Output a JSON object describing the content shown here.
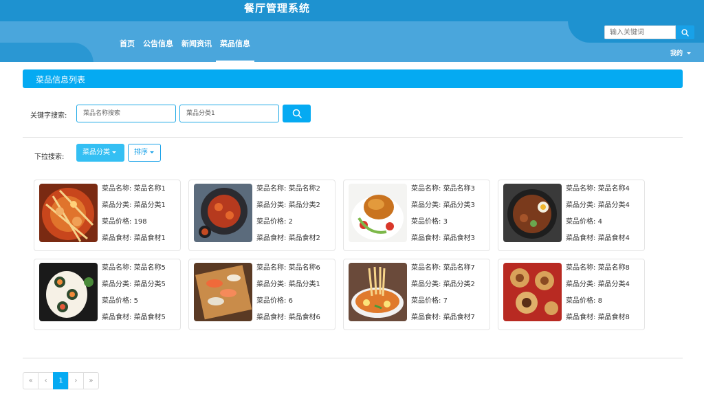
{
  "header": {
    "title": "餐厅管理系统",
    "nav": [
      "首页",
      "公告信息",
      "新闻资讯",
      "菜品信息"
    ],
    "active_nav": 3,
    "search_placeholder": "输入关键词",
    "user_menu": "我的"
  },
  "section": {
    "title": "菜品信息列表"
  },
  "keyword_search": {
    "label": "关键字搜索:",
    "name_placeholder": "菜品名称搜索",
    "category_value": "菜品分类1"
  },
  "dropdown_search": {
    "label": "下拉搜索:",
    "category_button": "菜品分类",
    "sort_button": "排序"
  },
  "field_labels": {
    "name": "菜品名称:",
    "category": "菜品分类:",
    "price": "菜品价格:",
    "ingredient": "菜品食材:"
  },
  "dishes": [
    {
      "name": "菜品名称1",
      "category": "菜品分类1",
      "price": "198",
      "ingredient": "菜品食材1"
    },
    {
      "name": "菜品名称2",
      "category": "菜品分类2",
      "price": "2",
      "ingredient": "菜品食材2"
    },
    {
      "name": "菜品名称3",
      "category": "菜品分类3",
      "price": "3",
      "ingredient": "菜品食材3"
    },
    {
      "name": "菜品名称4",
      "category": "菜品分类4",
      "price": "4",
      "ingredient": "菜品食材4"
    },
    {
      "name": "菜品名称5",
      "category": "菜品分类5",
      "price": "5",
      "ingredient": "菜品食材5"
    },
    {
      "name": "菜品名称6",
      "category": "菜品分类1",
      "price": "6",
      "ingredient": "菜品食材6"
    },
    {
      "name": "菜品名称7",
      "category": "菜品分类2",
      "price": "7",
      "ingredient": "菜品食材7"
    },
    {
      "name": "菜品名称8",
      "category": "菜品分类4",
      "price": "8",
      "ingredient": "菜品食材8"
    }
  ],
  "pagination": {
    "first": "«",
    "prev": "‹",
    "current": "1",
    "next": "›",
    "last": "»"
  },
  "colors": {
    "header_blue": "#1e92d0",
    "nav_blue": "#4aa6dc",
    "accent": "#05aaf2"
  }
}
